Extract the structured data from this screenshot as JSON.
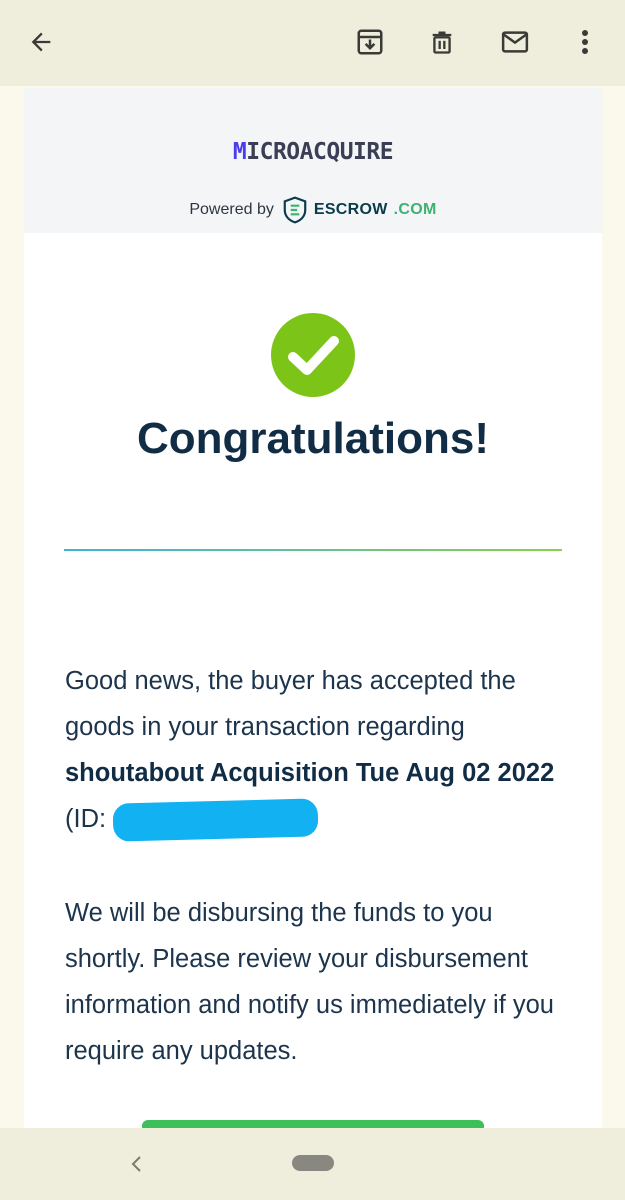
{
  "toolbar": {
    "back": "back-arrow-icon",
    "archive": "archive-icon",
    "delete": "trash-icon",
    "mark_unread": "mail-icon",
    "more": "more-vert-icon"
  },
  "email": {
    "brand_first": "M",
    "brand_rest": "ICROACQUIRE",
    "powered_by": "Powered by",
    "escrow_name": "ESCROW",
    "escrow_suffix": ".COM",
    "title": "Congratulations!",
    "para1_before": "Good news, the buyer has accepted the goods in your transaction regarding ",
    "para1_bold": "shoutabout Acquisition Tue Aug 02 2022",
    "para1_after": " (ID: ",
    "para2": "We will be disbursing the funds to you shortly. Please review your disbursement information and notify us immediately if you require any updates."
  },
  "colors": {
    "accent_green": "#3dbf5a",
    "check_green": "#7cc417",
    "title_navy": "#112c45",
    "redaction_blue": "#12b2f2",
    "appbar_bg": "#efeedd"
  },
  "nav": {
    "back": "nav-back-icon",
    "home": "home-pill"
  }
}
